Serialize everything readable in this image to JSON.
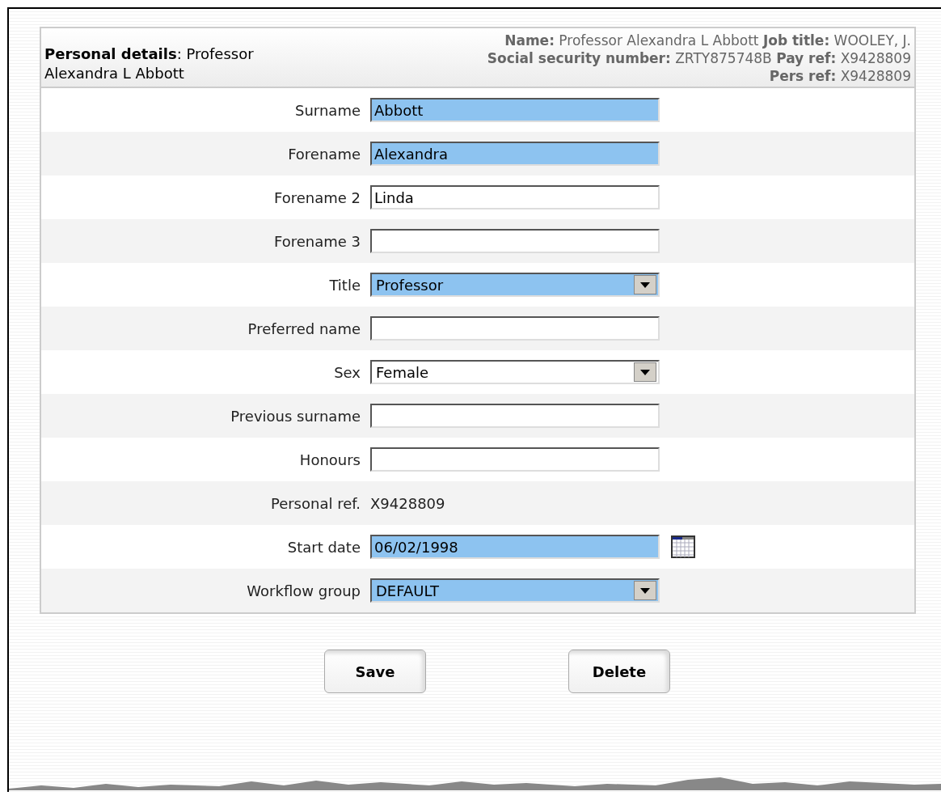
{
  "header": {
    "title": "**Personal details**: Professor Alexandra L Abbott",
    "summary_lines": [
      "**Name:** Professor Alexandra L Abbott **Job title:** WOOLEY, J.",
      "**Social security number:** ZRTY875748B **Pay ref:** X9428809",
      "**Pers ref:** X9428809"
    ]
  },
  "fields": [
    {
      "kind": "text",
      "label": "Surname",
      "value": "Abbott",
      "highlighted": true
    },
    {
      "kind": "text",
      "label": "Forename",
      "value": "Alexandra",
      "highlighted": true
    },
    {
      "kind": "text",
      "label": "Forename 2",
      "value": "Linda",
      "highlighted": false
    },
    {
      "kind": "text",
      "label": "Forename 3",
      "highlighted": false
    },
    {
      "kind": "select",
      "label": "Title",
      "value": "Professor",
      "highlighted": true
    },
    {
      "kind": "text",
      "label": "Preferred name",
      "highlighted": false
    },
    {
      "kind": "select",
      "label": "Sex",
      "value": "Female",
      "highlighted": false
    },
    {
      "kind": "text",
      "label": "Previous surname",
      "highlighted": false
    },
    {
      "kind": "text",
      "label": "Honours",
      "highlighted": false
    },
    {
      "kind": "readonly",
      "label": "Personal ref.",
      "value": "X9428809"
    },
    {
      "kind": "date",
      "label": "Start date",
      "value": "06/02/1998",
      "highlighted": true
    },
    {
      "kind": "select",
      "label": "Workflow group",
      "value": "DEFAULT",
      "highlighted": true
    }
  ],
  "buttons": [
    "Save",
    "Delete"
  ]
}
